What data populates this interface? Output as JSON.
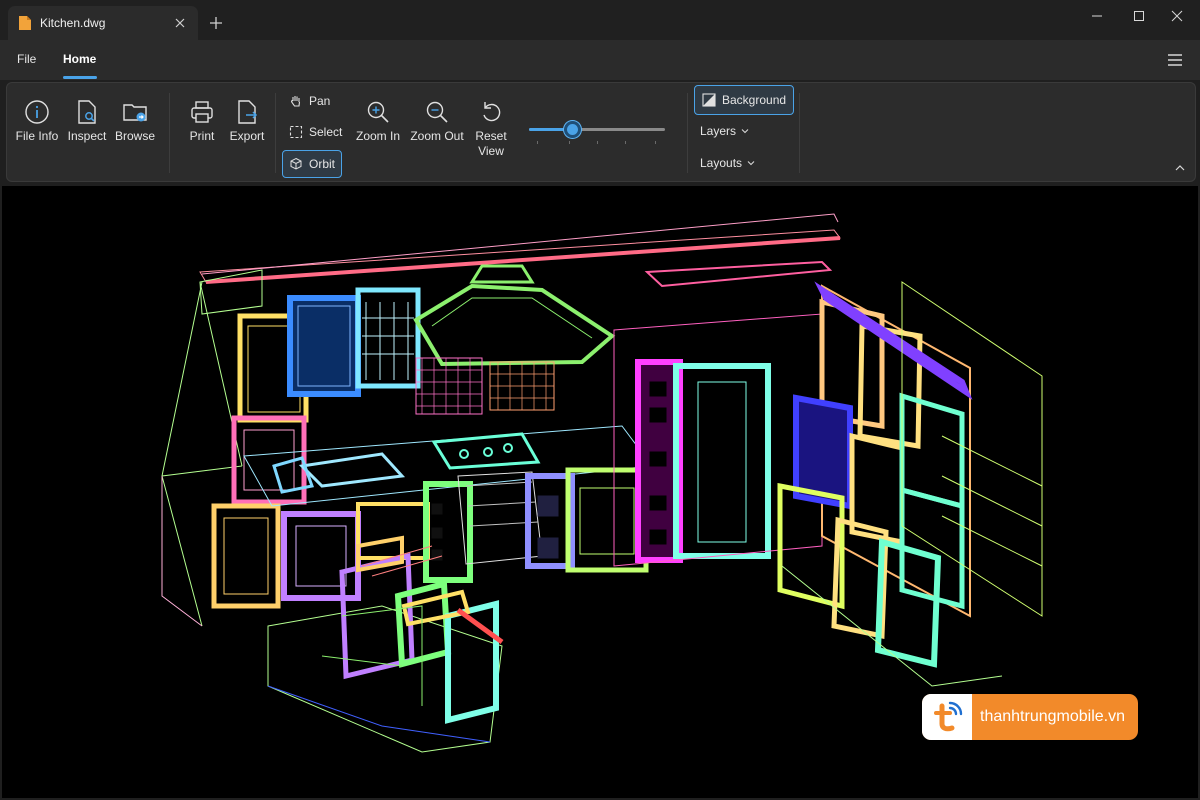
{
  "window": {
    "tab_title": "Kitchen.dwg",
    "icons": {
      "file": "file-icon",
      "close_tab": "close-icon",
      "new_tab": "plus-icon",
      "minimize": "minimize-icon",
      "maximize": "maximize-icon",
      "close": "close-icon"
    }
  },
  "menu": {
    "items": [
      {
        "label": "File"
      },
      {
        "label": "Home"
      }
    ],
    "active": "Home"
  },
  "ribbon": {
    "file_group": [
      {
        "label": "File Info",
        "icon": "info-icon"
      },
      {
        "label": "Inspect",
        "icon": "inspect-icon"
      },
      {
        "label": "Browse",
        "icon": "folder-icon"
      }
    ],
    "output_group": [
      {
        "label": "Print",
        "icon": "printer-icon"
      },
      {
        "label": "Export",
        "icon": "export-icon"
      }
    ],
    "navigation": {
      "pan": "Pan",
      "select": "Select",
      "orbit": "Orbit",
      "zoom_in": "Zoom In",
      "zoom_out": "Zoom Out",
      "reset_view_line1": "Reset",
      "reset_view_line2": "View"
    },
    "zoom_slider": {
      "value": 0.32
    },
    "display": {
      "background": "Background",
      "layers": "Layers",
      "layouts": "Layouts"
    }
  },
  "watermark": {
    "text": "thanhtrungmobile.vn"
  },
  "colors": {
    "accent": "#4aa3e8",
    "watermark_orange": "#f28a2a",
    "canvas": "#000000"
  }
}
